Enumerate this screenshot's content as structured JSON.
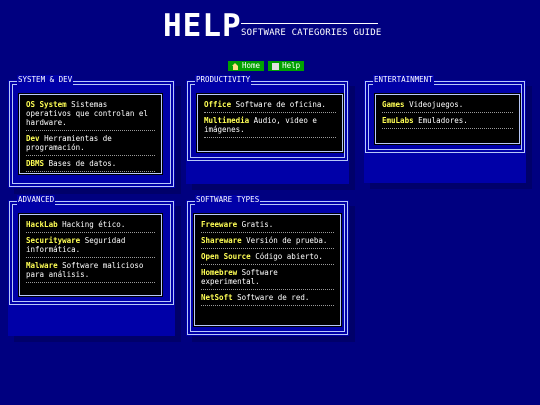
{
  "header": {
    "title": "HELP",
    "subtitle": "SOFTWARE CATEGORIES GUIDE"
  },
  "nav": {
    "home_label": "Home",
    "help_label": "Help"
  },
  "panels": [
    {
      "label": "SYSTEM & DEV",
      "entries": [
        {
          "term": "OS System",
          "desc": "Sistemas operativos que controlan el hardware."
        },
        {
          "term": "Dev",
          "desc": "Herramientas de programación."
        },
        {
          "term": "DBMS",
          "desc": "Bases de datos."
        }
      ]
    },
    {
      "label": "PRODUCTIVITY",
      "entries": [
        {
          "term": "Office",
          "desc": "Software de oficina."
        },
        {
          "term": "Multimedia",
          "desc": "Audio, video e imágenes."
        }
      ]
    },
    {
      "label": "ENTERTAINMENT",
      "entries": [
        {
          "term": "Games",
          "desc": "Videojuegos."
        },
        {
          "term": "EmuLabs",
          "desc": "Emuladores."
        }
      ]
    },
    {
      "label": "ADVANCED",
      "entries": [
        {
          "term": "HackLab",
          "desc": "Hacking ético."
        },
        {
          "term": "Securityware",
          "desc": "Seguridad informática."
        },
        {
          "term": "Malware",
          "desc": "Software malicioso para análisis."
        }
      ]
    },
    {
      "label": "SOFTWARE TYPES",
      "entries": [
        {
          "term": "Freeware",
          "desc": "Gratis."
        },
        {
          "term": "Shareware",
          "desc": "Versión de prueba."
        },
        {
          "term": "Open Source",
          "desc": "Código abierto."
        },
        {
          "term": "Homebrew",
          "desc": "Software experimental."
        },
        {
          "term": "NetSoft",
          "desc": "Software de red."
        }
      ]
    }
  ],
  "colors": {
    "background": "#000080",
    "panel": "#0000a8",
    "term": "#ffff55",
    "nav_button": "#00a000",
    "frame": "#b8c8f8"
  }
}
